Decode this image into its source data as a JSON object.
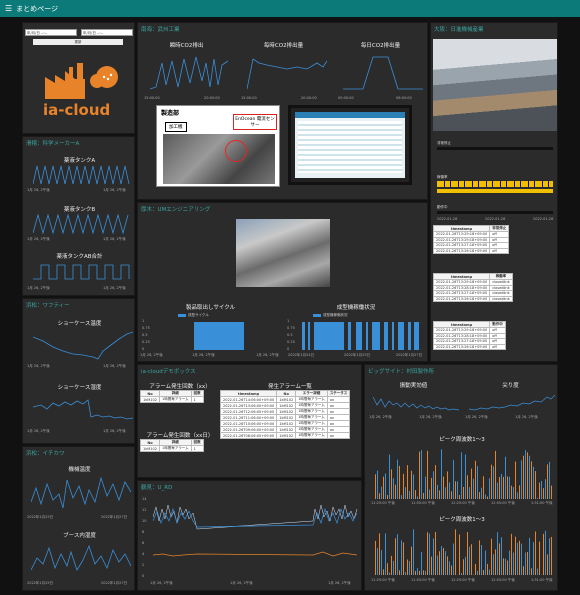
{
  "header": {
    "menu_icon": "hamburger-icon",
    "title": "まとめページ"
  },
  "filters": {
    "date_placeholder": "年/月/日 --:--",
    "update_label": "更新"
  },
  "logo": {
    "text": "ia-cloud"
  },
  "panels": {
    "kagaku": {
      "title": "滑稽：科学メーカーA",
      "charts": [
        {
          "title": "薬液タンクA",
          "x_start": "1月 26, 2午後",
          "x_end": "1月 26, 2午後"
        },
        {
          "title": "薬液タンクB",
          "x_start": "1月 26, 2午後",
          "x_end": "1月 26, 2午後"
        },
        {
          "title": "薬液タンクAB合計",
          "x_start": "1月 26, 2午後",
          "x_end": "1月 26, 2午後"
        }
      ]
    },
    "wafty": {
      "title": "浜松：ワフティー",
      "charts": [
        {
          "title": "ショーケース温度",
          "x_start": "1月 26, 2午後",
          "x_end": "1月 26, 2午後"
        },
        {
          "title": "ショーケース湿度",
          "x_start": "1月 26, 2午後",
          "x_end": "1月 26, 2午後"
        }
      ]
    },
    "ikagawa": {
      "title": "浜松：イチカワ",
      "charts": [
        {
          "title": "機械温度",
          "x_start": "2022年1月25日",
          "x_end": "2022年1月27日"
        },
        {
          "title": "ブース内湿度",
          "x_start": "2022年1月25日",
          "x_end": "2022年1月27日"
        }
      ]
    },
    "bukai": {
      "title": "南海：武州工業",
      "charts": [
        {
          "title": "瞬時CO2排出",
          "ticks": [
            "15:00:00",
            "20:00:00"
          ]
        },
        {
          "title": "毎時CO2排出量",
          "ticks": [
            "15:00:00",
            "20:00:00"
          ]
        },
        {
          "title": "毎日CO2排出量",
          "ticks": [
            "00:00:00",
            "06:00:00"
          ]
        }
      ],
      "photo_label": "製造部",
      "photo_sublabel": "加工機",
      "photo_callout": "EnOcean 電流センサー"
    },
    "um": {
      "title": "厚木：UMエンジニアリング",
      "charts": [
        {
          "title": "製品取出しサイクル",
          "legend": "成型サイクル",
          "x_start": "1月 26, 2午後",
          "x_mid": "1月 26, 2午後",
          "x_end": "1月 26, 2午後",
          "yticks": [
            "1",
            "0.75",
            "0.5",
            "0.25",
            "0"
          ]
        },
        {
          "title": "成型機稼働状況",
          "legend": "成型機稼働状況",
          "x_start": "2022年1月24日",
          "x_mid": "2022年1月25日",
          "x_end": "2022年1月27日",
          "yticks": [
            "1",
            "0.75",
            "0.5",
            "0.25",
            "0"
          ]
        }
      ]
    },
    "gear": {
      "title": "ia-cloudデモボックス",
      "alarm_count": {
        "title": "アラーム発生回数（xx）",
        "headers": [
          "No",
          "詳細",
          "回数"
        ],
        "rows": [
          [
            "1kM102",
            "1時間毎アラーム",
            "1"
          ]
        ]
      },
      "alarm_count2": {
        "title": "アラーム発生回数（xx日）",
        "headers": [
          "No",
          "詳細",
          "回数"
        ],
        "rows": [
          [
            "1kM102",
            "1時間毎アラーム",
            "1"
          ]
        ]
      },
      "alarm_list": {
        "title": "発生アラーム一覧",
        "headers": [
          "timestamp",
          "No",
          "エラー詳細",
          "ステータス"
        ],
        "rows": [
          [
            "2022-01-26T14:06:00+09:00",
            "1kM102",
            "1時間毎アラーム",
            "on"
          ],
          [
            "2022-01-26T13:06:00+09:00",
            "1kM102",
            "1時間毎アラーム",
            "on"
          ],
          [
            "2022-01-26T12:06:00+09:00",
            "1kM102",
            "1時間毎アラーム",
            "on"
          ],
          [
            "2022-01-26T11:06:00+09:00",
            "1kM102",
            "1時間毎アラーム",
            "on"
          ],
          [
            "2022-01-26T10:06:00+09:00",
            "1kM102",
            "1時間毎アラーム",
            "on"
          ],
          [
            "2022-01-26T09:06:00+09:00",
            "1kM102",
            "1時間毎アラーム",
            "on"
          ],
          [
            "2022-01-26T08:06:00+09:00",
            "1kM102",
            "1時間毎アラーム",
            "on"
          ]
        ]
      }
    },
    "kurume": {
      "title": "鶴見：U_RD",
      "x_ticks": [
        "1月 26, 2午後",
        "1月 26, 2午後",
        "1月 26, 2午後"
      ],
      "y_ticks": [
        "14",
        "12",
        "10",
        "8",
        "6",
        "4",
        "2",
        "0"
      ]
    },
    "osaka": {
      "title": "大阪：日進機械産業",
      "row_labels": [
        "非常停止",
        "稼働率",
        "動作中"
      ],
      "tl_ticks": [
        "2022-01-26",
        "2022-01-26",
        "2022-01-26",
        "2022-01-26",
        "2022-01-26"
      ],
      "tables": [
        {
          "headers": [
            "timestamp",
            "非常停止"
          ],
          "rows": [
            [
              "2022-01-26T13:29:18+09:00",
              "off"
            ],
            [
              "2022-01-26T13:29:18+09:00",
              "off"
            ],
            [
              "2022-01-26T13:27:18+09:00",
              "off"
            ],
            [
              "2022-01-26T13:26:18+09:00",
              "off"
            ]
          ]
        },
        {
          "headers": [
            "timestamp",
            "稼働率"
          ],
          "rows": [
            [
              "2022-01-26T13:29:18+09:00",
              "closedlink"
            ],
            [
              "2022-01-26T13:28:18+09:00",
              "closedlink"
            ],
            [
              "2022-01-26T13:27:18+09:00",
              "closedlink"
            ],
            [
              "2022-01-26T13:26:18+09:00",
              "closedlink"
            ]
          ]
        },
        {
          "headers": [
            "timestamp",
            "動作中"
          ],
          "rows": [
            [
              "2022-01-26T13:29:18+09:00",
              "off"
            ],
            [
              "2022-01-26T13:28:18+09:00",
              "off"
            ],
            [
              "2022-01-26T13:27:18+09:00",
              "off"
            ],
            [
              "2022-01-26T13:26:18+09:00",
              "off"
            ]
          ]
        }
      ]
    },
    "bigsite": {
      "title": "ビッグサイト：村田製作所",
      "charts": [
        {
          "title": "振動実効値",
          "x_start": "1月 26, 2午後",
          "x_end": "1月 26, 2午後"
        },
        {
          "title": "尖り度",
          "x_start": "1月 26, 2午後",
          "x_end": "1月 26, 2午後"
        },
        {
          "title": "ピーク周波数1〜3",
          "ticks": [
            "11:25:00 午後",
            "11:55:00 午後",
            "12:25:00 午後",
            "12:55:00 午後",
            "1:31:00 午後"
          ]
        },
        {
          "title": "ピーク周波数1〜3",
          "ticks": [
            "11:25:00 午後",
            "11:55:00 午後",
            "12:25:00 午後",
            "12:55:00 午後",
            "1:31:00 午後"
          ]
        }
      ]
    }
  },
  "colors": {
    "accent": "#0b7a78",
    "panel": "#2b2b2b",
    "series_blue": "#3a8fd9",
    "series_orange": "#e8832a",
    "timeline_yellow": "#f0c000"
  }
}
